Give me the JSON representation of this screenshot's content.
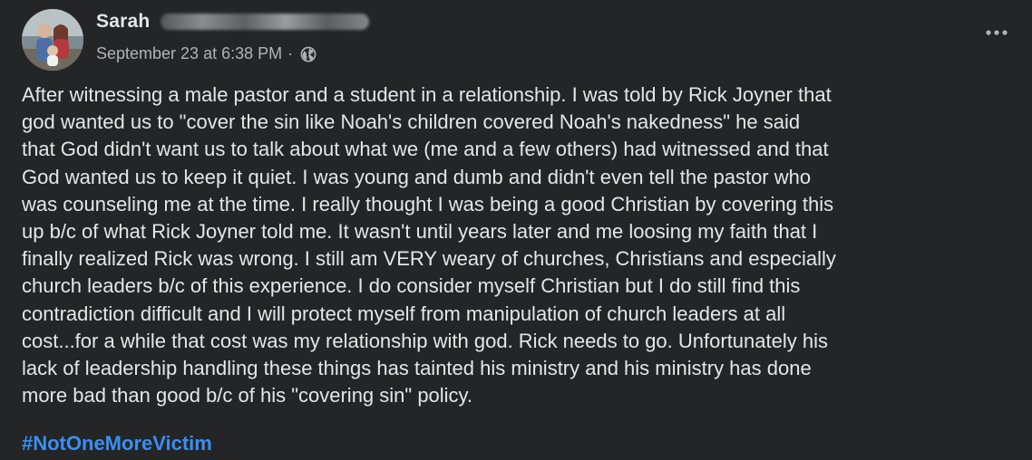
{
  "post": {
    "author_first_name": "Sarah",
    "timestamp": "September 23 at 6:38 PM",
    "separator": "·",
    "privacy_icon": "globe-icon",
    "menu_icon": "more-options-icon",
    "body": "After witnessing a male pastor and a student in a relationship. I was told by Rick Joyner that\ngod wanted us to \"cover the sin like Noah's children covered Noah's nakedness\" he said\nthat God didn't want us to talk about what we (me and a few others) had witnessed and that\nGod wanted us to keep it quiet. I was young and dumb and didn't even tell the pastor who\nwas counseling me at the time. I really thought I was being a good Christian by covering this\nup b/c of what Rick Joyner told me. It wasn't until years later and me loosing my faith that I\nfinally realized Rick was wrong. I still am VERY weary of churches, Christians and especially\nchurch leaders b/c of this experience. I do consider myself Christian but I do still find this\ncontradiction difficult and I will protect myself from manipulation of church leaders at all\ncost...for a while that cost was my relationship with god. Rick needs to go. Unfortunately his\nlack of leadership handling these things has tainted his ministry and his ministry has done\nmore bad than good b/c of his \"covering sin\" policy.",
    "hashtag": "#NotOneMoreVictim"
  },
  "colors": {
    "background": "#242526",
    "primary_text": "#e4e6eb",
    "secondary_text": "#b0b3b8",
    "link": "#3b8ff2"
  }
}
